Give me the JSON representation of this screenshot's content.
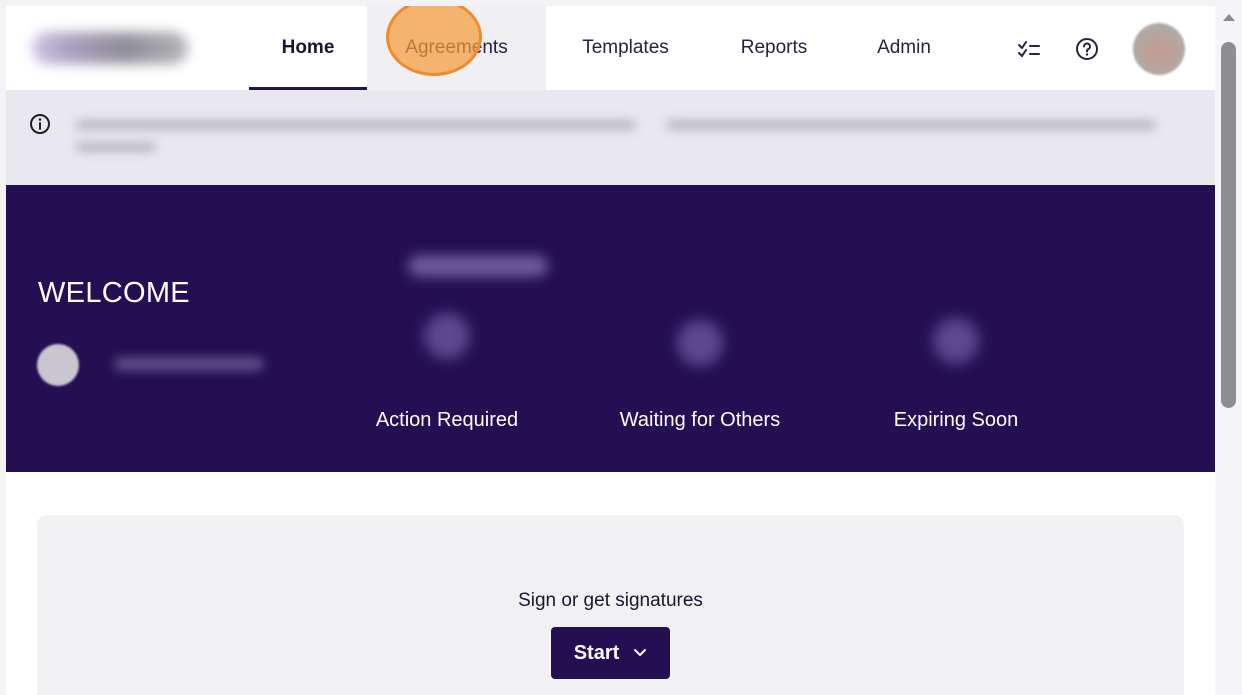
{
  "nav": {
    "logo": "brand-logo",
    "tabs": [
      {
        "label": "Home",
        "active": true
      },
      {
        "label": "Agreements",
        "active": false
      },
      {
        "label": "Templates",
        "active": false
      },
      {
        "label": "Reports",
        "active": false
      },
      {
        "label": "Admin",
        "active": false
      }
    ],
    "icons": {
      "tasks": "tasks-checklist-icon",
      "help": "help-circle-icon",
      "profile": "user-avatar"
    }
  },
  "banner": {
    "icon": "info-circle-icon"
  },
  "hero": {
    "welcome": "WELCOME",
    "stats": [
      {
        "label": "Action Required"
      },
      {
        "label": "Waiting for Others"
      },
      {
        "label": "Expiring Soon"
      }
    ]
  },
  "main": {
    "card_title": "Sign or get signatures",
    "start_label": "Start",
    "start_icon": "chevron-down-icon"
  },
  "colors": {
    "brand_dark": "#230f52",
    "banner_bg": "#e9e8ee",
    "card_bg": "#f1f1f4",
    "click_marker": "#ef8b2c"
  }
}
